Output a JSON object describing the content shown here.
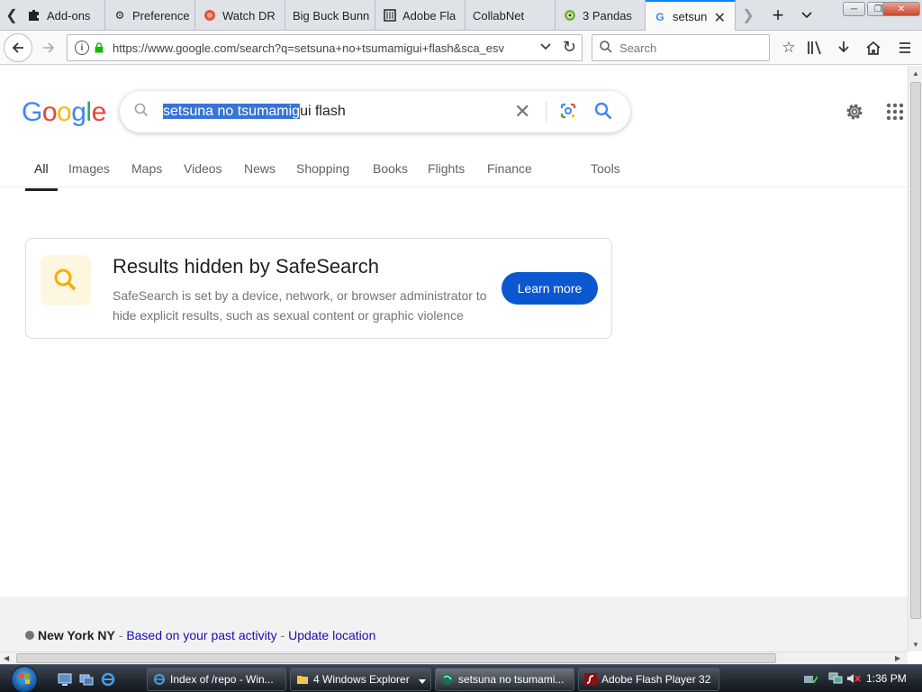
{
  "browser": {
    "tabs": [
      {
        "label": "Add-ons",
        "icon": "puzzle-icon"
      },
      {
        "label": "Preference",
        "icon": "gear-icon"
      },
      {
        "label": "Watch DR",
        "icon": "watch-icon"
      },
      {
        "label": "Big Buck Bunn",
        "icon": ""
      },
      {
        "label": "Adobe Fla",
        "icon": "adobe-icon"
      },
      {
        "label": "CollabNet",
        "icon": ""
      },
      {
        "label": "3 Pandas",
        "icon": "panda-icon"
      },
      {
        "label": "setsun",
        "icon": "google-icon"
      }
    ],
    "url": "https://www.google.com/search?q=setsuna+no+tsumamigui+flash&sca_esv",
    "url_domain": "google.com",
    "search_placeholder": "Search"
  },
  "google": {
    "logo": "Google",
    "query_selected": "setsuna no tsumamig",
    "query_rest": "ui flash",
    "tabs": [
      "All",
      "Images",
      "Maps",
      "Videos",
      "News",
      "Shopping",
      "Books",
      "Flights",
      "Finance",
      "Tools"
    ],
    "safesearch": {
      "title": "Results hidden by SafeSearch",
      "body": "SafeSearch is set by a device, network, or browser administrator to hide explicit results, such as sexual content or graphic violence",
      "button": "Learn more"
    },
    "location": {
      "place": "New York NY",
      "sep1": " - ",
      "based": "Based on your past activity",
      "sep2": " - ",
      "update": "Update location"
    }
  },
  "taskbar": {
    "tasks": [
      {
        "label": "Index of /repo - Win...",
        "icon": "ie-icon"
      },
      {
        "label": "4 Windows Explorer",
        "icon": "folder-icon"
      },
      {
        "label": "setsuna no tsumami...",
        "icon": "firefox-icon"
      },
      {
        "label": "Adobe Flash Player 32",
        "icon": "flash-icon"
      }
    ],
    "clock": "1:36 PM"
  },
  "colors": {
    "google_blue": "#4285F4",
    "google_red": "#EA4335",
    "google_yellow": "#FBBC05",
    "google_green": "#34A853",
    "button_blue": "#0b57d0",
    "selection": "#3874d8"
  }
}
